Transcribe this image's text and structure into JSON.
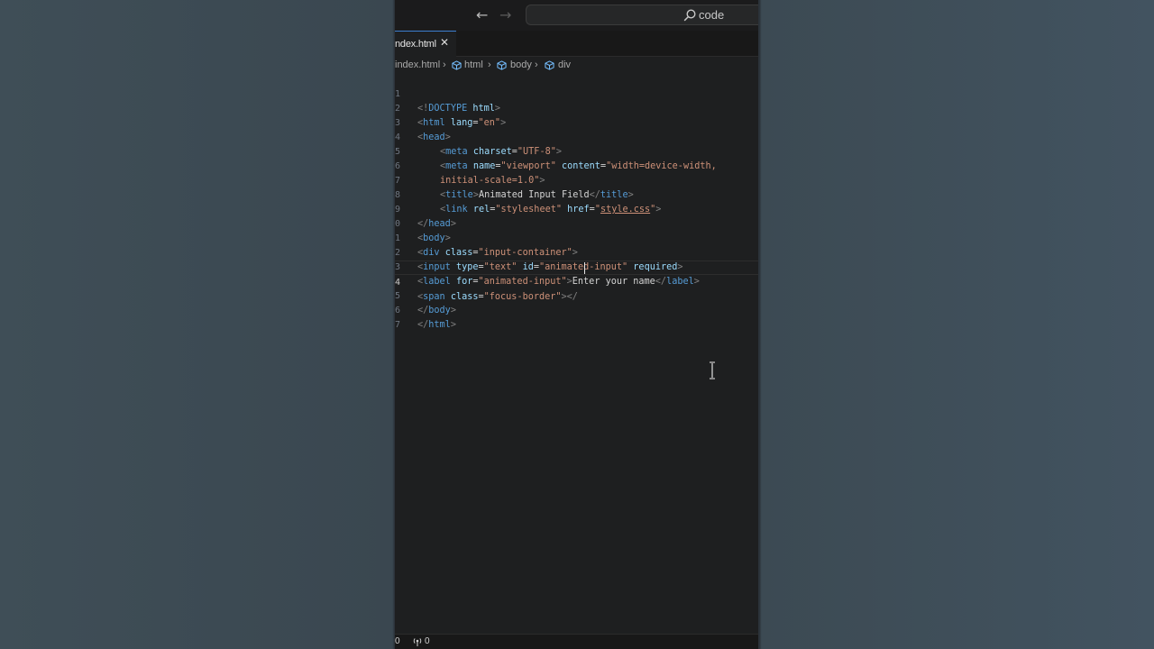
{
  "titlebar": {
    "search_label": "code"
  },
  "tabs": [
    {
      "label": "ndex.html",
      "close": "✕"
    }
  ],
  "breadcrumb": {
    "file": "index.html",
    "items": [
      "html",
      "body",
      "div"
    ]
  },
  "editor": {
    "line_numbers": [
      "1",
      "2",
      "3",
      "4",
      "5",
      "6",
      "7",
      "8",
      "9",
      "0",
      "1",
      "2",
      "3",
      "4",
      "5",
      "6",
      "7"
    ]
  },
  "statusbar": {
    "errors": "0",
    "ports": "0"
  },
  "colors": {
    "editor_bg": "#1e1f20",
    "tag": "#569cd6",
    "attribute": "#9cdcfe",
    "string": "#ce9178",
    "text": "#d4d4d4",
    "punctuation": "#808080",
    "active_tab_accent": "#3c7fd0"
  },
  "icons": {
    "back": "arrow-left-icon",
    "forward": "arrow-right-icon",
    "search": "search-icon",
    "close": "close-icon",
    "breadcrumb_symbol": "cube-icon",
    "ports": "radio-tower-icon",
    "cursor": "text-cursor-icon"
  }
}
